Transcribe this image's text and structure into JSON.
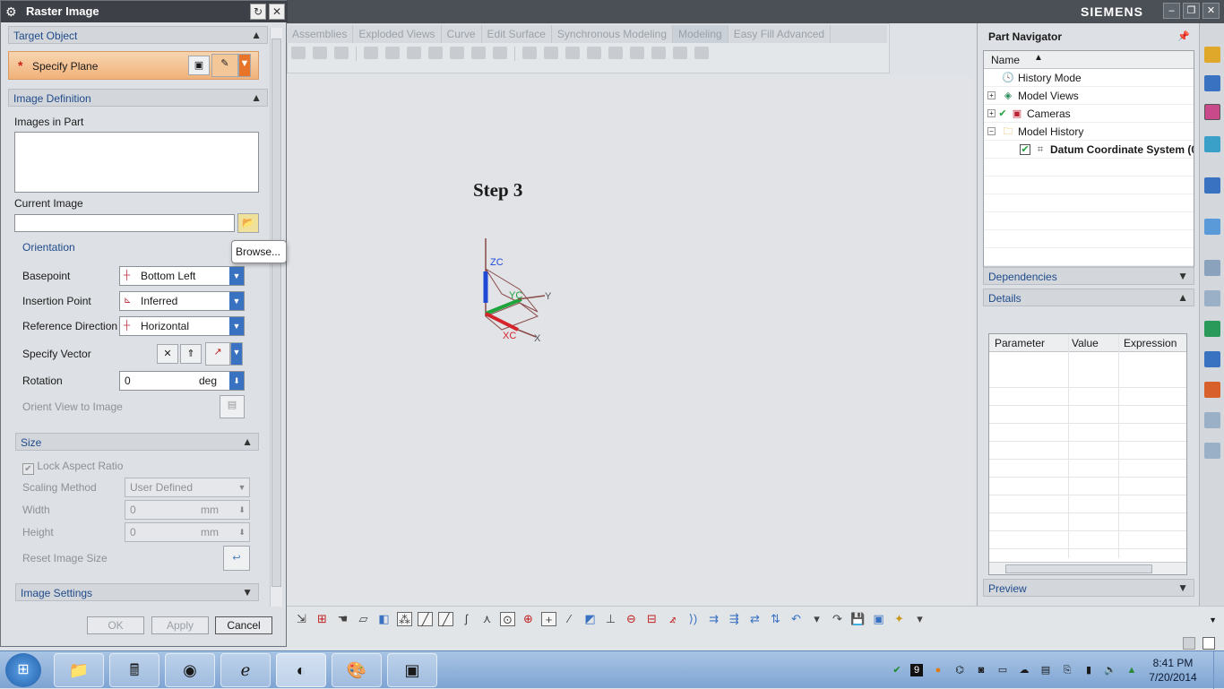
{
  "app": {
    "brand": "SIEMENS",
    "tabs": [
      "Assemblies",
      "Exploded Views",
      "Curve",
      "Edit Surface",
      "Synchronous Modeling",
      "Modeling",
      "Easy Fill Advanced"
    ],
    "active_tab": "Modeling"
  },
  "graphics": {
    "step_title": "Step 3",
    "axis_labels": {
      "zc": "ZC",
      "yc": "YC",
      "y": "Y",
      "xc": "XC",
      "x": "X"
    }
  },
  "dialog": {
    "title": "Raster Image",
    "target_object": {
      "header": "Target Object",
      "specify_plane": "Specify Plane"
    },
    "image_definition": {
      "header": "Image Definition",
      "images_in_part_label": "Images in Part",
      "current_image_label": "Current Image",
      "current_image_value": "",
      "browse_tooltip": "Browse..."
    },
    "orientation": {
      "header": "Orientation",
      "basepoint_label": "Basepoint",
      "basepoint_value": "Bottom Left",
      "insertion_point_label": "Insertion Point",
      "insertion_point_value": "Inferred",
      "reference_direction_label": "Reference Direction",
      "reference_direction_value": "Horizontal",
      "specify_vector_label": "Specify Vector",
      "rotation_label": "Rotation",
      "rotation_value": "0",
      "rotation_unit": "deg",
      "orient_view_label": "Orient View to Image"
    },
    "size": {
      "header": "Size",
      "lock_aspect_ratio": "Lock Aspect Ratio",
      "lock_aspect_checked": true,
      "scaling_method_label": "Scaling Method",
      "scaling_method_value": "User Defined",
      "width_label": "Width",
      "width_value": "0",
      "width_unit": "mm",
      "height_label": "Height",
      "height_value": "0",
      "height_unit": "mm",
      "reset_label": "Reset Image Size"
    },
    "image_settings_header": "Image Settings",
    "buttons": {
      "ok": "OK",
      "apply": "Apply",
      "cancel": "Cancel"
    }
  },
  "navigator": {
    "title": "Part Navigator",
    "column_name": "Name",
    "tree": [
      {
        "label": "History Mode",
        "icon": "clock-icon"
      },
      {
        "label": "Model Views",
        "icon": "cube-icon"
      },
      {
        "label": "Cameras",
        "icon": "camera-icon"
      },
      {
        "label": "Model History",
        "icon": "folder-icon"
      },
      {
        "label": "Datum Coordinate System (0",
        "icon": "datum-icon"
      }
    ],
    "dependencies": "Dependencies",
    "details": "Details",
    "details_columns": [
      "Parameter",
      "Value",
      "Expression"
    ],
    "preview": "Preview"
  },
  "taskbar": {
    "time": "8:41 PM",
    "date": "7/20/2014",
    "tray_badge": "9"
  }
}
